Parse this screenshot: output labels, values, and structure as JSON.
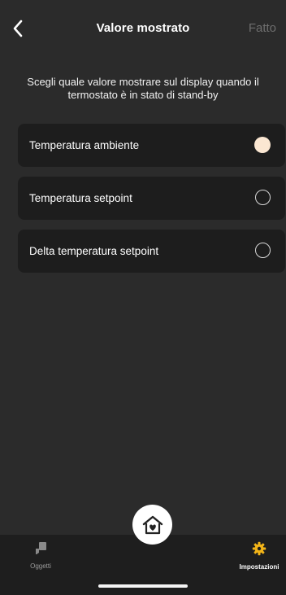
{
  "header": {
    "title": "Valore mostrato",
    "done_label": "Fatto"
  },
  "description": "Scegli quale valore mostrare sul display quando il termostato è in stato di stand-by",
  "options": [
    {
      "label": "Temperatura ambiente",
      "selected": true
    },
    {
      "label": "Temperatura setpoint",
      "selected": false
    },
    {
      "label": "Delta temperatura setpoint",
      "selected": false
    }
  ],
  "tabbar": {
    "objects_label": "Oggetti",
    "settings_label": "Impostazioni"
  },
  "icons": {
    "back": "chevron-left-icon",
    "home": "house-heart-icon",
    "objects": "object-icon",
    "settings": "gear-icon"
  },
  "colors": {
    "background": "#2b2b2b",
    "card": "#1d1d1d",
    "selected_radio": "#fbe7d2",
    "accent": "#f2b418",
    "muted": "#6e6e6e"
  }
}
